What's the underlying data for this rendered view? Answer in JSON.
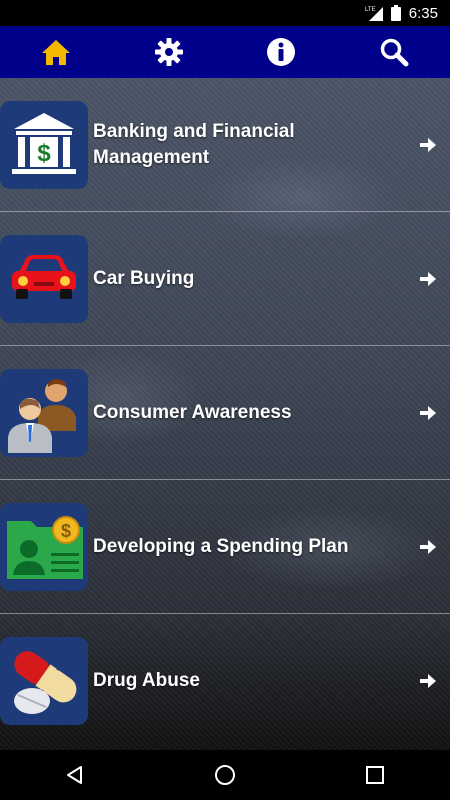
{
  "status_bar": {
    "network": "LTE",
    "time": "6:35"
  },
  "nav": {
    "home_icon": "home-icon",
    "settings_icon": "gear-icon",
    "info_icon": "info-icon",
    "search_icon": "search-icon",
    "active_color": "#f5b800",
    "bar_color": "#00008a"
  },
  "list": {
    "items": [
      {
        "label": "Banking and Financial Management",
        "icon": "bank-icon"
      },
      {
        "label": "Car Buying",
        "icon": "car-icon"
      },
      {
        "label": "Consumer Awareness",
        "icon": "people-icon"
      },
      {
        "label": "Developing a Spending Plan",
        "icon": "id-card-money-icon"
      },
      {
        "label": "Drug Abuse",
        "icon": "pill-icon"
      }
    ]
  },
  "system_nav": {
    "back": "back-icon",
    "home": "home-circle-icon",
    "recents": "recents-icon"
  }
}
